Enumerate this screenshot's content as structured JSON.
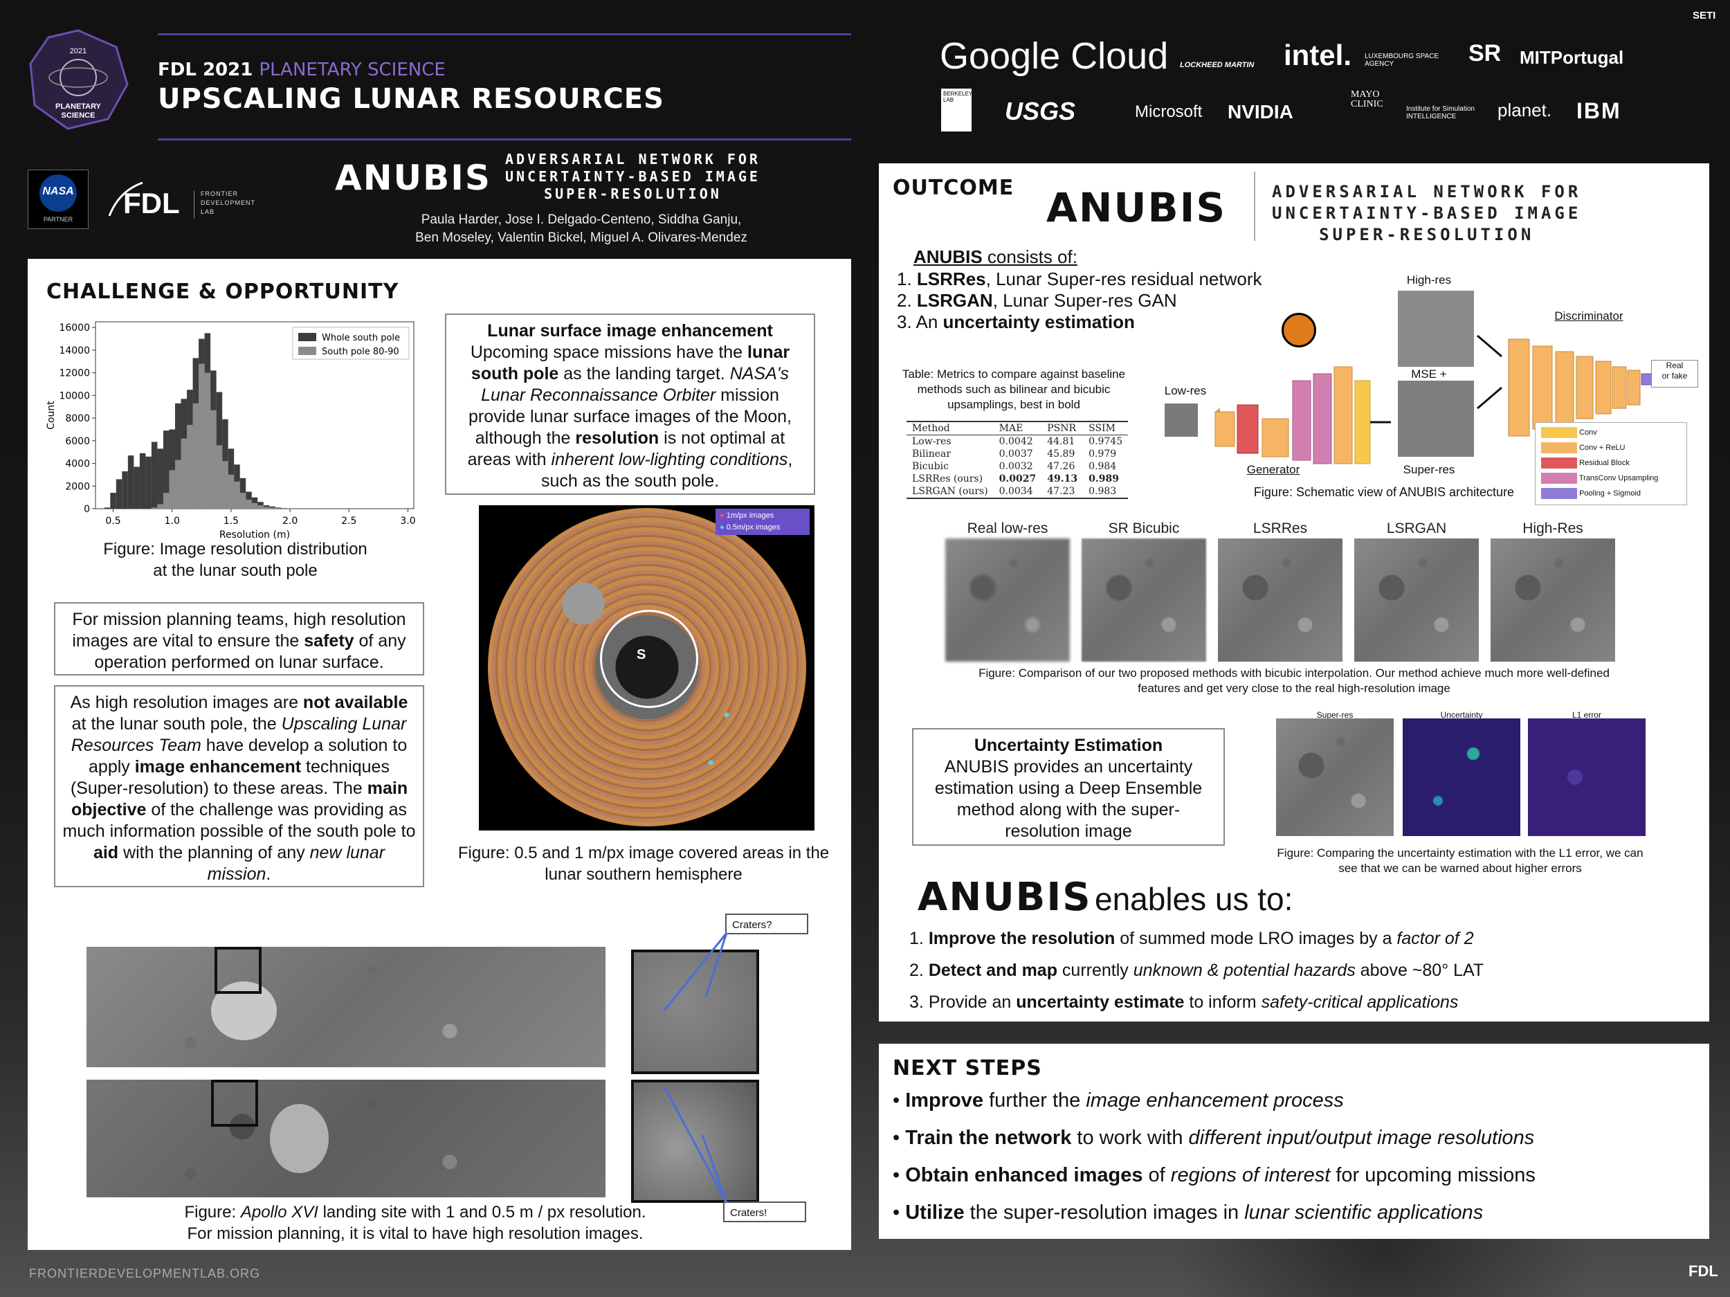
{
  "header": {
    "badge_year": "2021",
    "badge_line1": "PLANETARY",
    "badge_line2": "SCIENCE",
    "program": "FDL 2021",
    "program_accent": "PLANETARY SCIENCE",
    "title": "UPSCALING LUNAR RESOURCES",
    "nasa_label": "NASA",
    "nasa_partner": "PARTNER",
    "fdl_logo": "FDL",
    "fdl_sub": [
      "FRONTIER",
      "DEVELOPMENT",
      "LAB"
    ],
    "anubis_logo": "ANUBIS",
    "anubis_tagline": [
      "ADVERSARIAL NETWORK FOR",
      "UNCERTAINTY-BASED IMAGE",
      "SUPER-RESOLUTION"
    ],
    "authors_line1": "Paula Harder, Jose I. Delgado-Centeno, Siddha Ganju,",
    "authors_line2": "Ben Moseley, Valentin Bickel, Miguel A. Olivares-Mendez"
  },
  "partners": {
    "row1": [
      "Google Cloud",
      "LOCKHEED MARTIN",
      "intel.",
      "LUXEMBOURG SPACE AGENCY",
      "SR",
      "MITPortugal"
    ],
    "row2": [
      "BERKELEY LAB",
      "USGS",
      "Microsoft",
      "NVIDIA",
      "MAYO CLINIC",
      "Institute for Simulation INTELLIGENCE",
      "planet.",
      "IBM"
    ],
    "seti": "SETI"
  },
  "challenge": {
    "title": "CHALLENGE & OPPORTUNITY",
    "histogram_caption": "Figure: Image resolution distribution\nat the lunar south pole",
    "enhancement_box": {
      "heading": "Lunar surface image enhancement",
      "t1": "Upcoming space missions have the ",
      "b1": "lunar south pole",
      "t2": " as the landing target. ",
      "i1": "NASA's Lunar Reconnaissance Orbiter",
      "t3": " mission provide lunar surface images of the Moon, although the ",
      "b2": "resolution",
      "t4": " is not optimal at areas with ",
      "i2": "inherent low-lighting conditions",
      "t5": ", such as the south pole."
    },
    "safety_box": {
      "t1": "For mission planning teams, high resolution images are vital to ensure the ",
      "b1": "safety",
      "t2": " of any operation performed on lunar surface."
    },
    "solution_box": {
      "t1": "As high resolution images are ",
      "b1": "not available",
      "t2": " at the lunar south pole, the ",
      "i1": "Upscaling Lunar Resources Team",
      "t3": " have develop a solution to apply ",
      "b2": "image enhancement",
      "t4": " techniques (Super-resolution) to these areas. The ",
      "b3": "main objective",
      "t5": " of the challenge was providing as much information possible of the south pole to ",
      "b4": "aid",
      "t6": " with the planning of any ",
      "i2": "new lunar mission",
      "t7": "."
    },
    "map_legend": [
      "1m/px images",
      "0.5m/px images"
    ],
    "map_marker": "S",
    "map_caption": "Figure: 0.5 and 1 m/px image covered areas in the\nlunar southern hemisphere",
    "apollo_callout1": "Craters?",
    "apollo_callout2": "Craters!",
    "apollo_caption_italic": "Apollo XVI",
    "apollo_caption_pre": "Figure: ",
    "apollo_caption_post": " landing site with 1 and 0.5 m / px resolution.",
    "apollo_caption_line2": "For mission planning, it is vital to have high resolution images."
  },
  "chart_data": {
    "type": "bar",
    "title": "",
    "xlabel": "Resolution (m)",
    "ylabel": "Count",
    "xlim": [
      0.35,
      3.05
    ],
    "ylim": [
      0,
      16500
    ],
    "xticks": [
      "0.5",
      "1.0",
      "1.5",
      "2.0",
      "2.5",
      "3.0"
    ],
    "yticks": [
      "0",
      "2000",
      "4000",
      "6000",
      "8000",
      "10000",
      "12000",
      "14000",
      "16000"
    ],
    "legend_position": "top-right",
    "x": [
      0.45,
      0.5,
      0.55,
      0.6,
      0.65,
      0.7,
      0.75,
      0.8,
      0.85,
      0.9,
      0.95,
      1.0,
      1.05,
      1.1,
      1.15,
      1.2,
      1.25,
      1.3,
      1.35,
      1.4,
      1.45,
      1.5,
      1.55,
      1.6,
      1.65,
      1.7,
      1.75,
      1.8,
      1.85,
      1.9,
      1.95,
      2.0
    ],
    "series": [
      {
        "name": "Whole south pole",
        "color": "#3d3d3d",
        "values": [
          100,
          1400,
          2600,
          3300,
          4700,
          3700,
          4900,
          4600,
          5900,
          5300,
          6900,
          7000,
          9300,
          9700,
          10500,
          13300,
          15000,
          15500,
          12200,
          10300,
          7900,
          5300,
          3900,
          2700,
          1500,
          1000,
          600,
          300,
          200,
          100,
          50,
          30
        ]
      },
      {
        "name": "South pole 80-90",
        "color": "#8c8c8c",
        "values": [
          0,
          0,
          0,
          0,
          0,
          0,
          0,
          0,
          100,
          400,
          1400,
          3400,
          4300,
          6200,
          7400,
          9300,
          12800,
          12000,
          8700,
          5600,
          4200,
          3000,
          2400,
          1400,
          800,
          500,
          300,
          150,
          100,
          50,
          20,
          10
        ]
      }
    ]
  },
  "outcome": {
    "title": "OUTCOME",
    "anubis_logo": "ANUBIS",
    "anubis_tagline": [
      "ADVERSARIAL NETWORK FOR",
      "UNCERTAINTY-BASED IMAGE",
      "SUPER-RESOLUTION"
    ],
    "consists_heading": "ANUBIS",
    "consists_suffix": " consists of:",
    "items": [
      {
        "num": "1.",
        "bold": "LSRRes",
        "rest": ", Lunar Super-res residual network"
      },
      {
        "num": "2.",
        "bold": "LSRGAN",
        "rest": ", Lunar Super-res GAN"
      },
      {
        "num": "3.",
        "pre": "An ",
        "bold": "uncertainty estimation",
        "rest": ""
      }
    ],
    "table_caption": "Table: Metrics to compare against baseline methods such as bilinear and bicubic upsamplings, best in bold",
    "table_headers": [
      "Method",
      "MAE",
      "PSNR",
      "SSIM"
    ],
    "table_rows": [
      [
        "Low-res",
        "0.0042",
        "44.81",
        "0.9745"
      ],
      [
        "Bilinear",
        "0.0037",
        "45.89",
        "0.979"
      ],
      [
        "Bicubic",
        "0.0032",
        "47.26",
        "0.984"
      ],
      [
        "LSRRes (ours)",
        "0.0027",
        "49.13",
        "0.989"
      ],
      [
        "LSRGAN (ours)",
        "0.0034",
        "47.23",
        "0.983"
      ]
    ],
    "arch": {
      "low_res": "Low-res",
      "generator": "Generator",
      "high_res": "High-res",
      "mse": "MSE +",
      "super_res": "Super-res",
      "discriminator": "Discriminator",
      "real_fake": "Real\nor fake",
      "legend": [
        {
          "label": "Conv",
          "color": "#f7c84a"
        },
        {
          "label": "Conv + ReLU",
          "color": "#f5b565"
        },
        {
          "label": "Residual Block",
          "color": "#e0575a"
        },
        {
          "label": "TransConv Upsampling",
          "color": "#d27fb0"
        },
        {
          "label": "Pooling + Sigmoid",
          "color": "#8f7bd6"
        }
      ],
      "caption": "Figure: Schematic view of ANUBIS architecture"
    },
    "comparison_labels": [
      "Real low-res",
      "SR Bicubic",
      "LSRRes",
      "LSRGAN",
      "High-Res"
    ],
    "comparison_caption": "Figure: Comparison of our two proposed methods with bicubic interpolation. Our method achieve much more well-defined features and get very close to the real high-resolution image",
    "uncertainty_box": {
      "heading": "Uncertainty Estimation",
      "body": "ANUBIS provides an uncertainty estimation using a Deep Ensemble method along with the super-resolution image"
    },
    "unc_labels": [
      "Super-res",
      "Uncertainty",
      "L1 error"
    ],
    "unc_caption": "Figure: Comparing the uncertainty estimation with the L1 error, we can see that we can be warned about higher errors",
    "enables_logo": "ANUBIS",
    "enables_text": "enables us to:",
    "enables": [
      {
        "num": "1.",
        "bold": "Improve the resolution",
        "mid": " of summed mode LRO images by a ",
        "ital": "factor of 2",
        "end": ""
      },
      {
        "num": "2.",
        "bold": "Detect and map",
        "mid": " currently ",
        "ital": "unknown & potential hazards",
        "end": " above ~80° LAT"
      },
      {
        "num": "3.",
        "pre": "Provide an ",
        "bold": "uncertainty estimate",
        "mid": " to inform ",
        "ital": "safety-critical applications",
        "end": ""
      }
    ]
  },
  "next_steps": {
    "title": "NEXT STEPS",
    "items": [
      {
        "bold": "Improve",
        "mid": " further the ",
        "ital": "image enhancement process",
        "end": ""
      },
      {
        "bold": "Train the network",
        "mid": " to work with ",
        "ital": "different input/output image resolutions",
        "end": ""
      },
      {
        "bold": "Obtain enhanced images",
        "mid": " of ",
        "ital": "regions of interest",
        "end": " for upcoming missions"
      },
      {
        "bold": "Utilize",
        "mid": " the super-resolution images in ",
        "ital": "lunar scientific applications",
        "end": ""
      }
    ]
  },
  "footer": {
    "url": "FRONTIERDEVELOPMENTLAB.ORG",
    "fdl": "FDL"
  }
}
